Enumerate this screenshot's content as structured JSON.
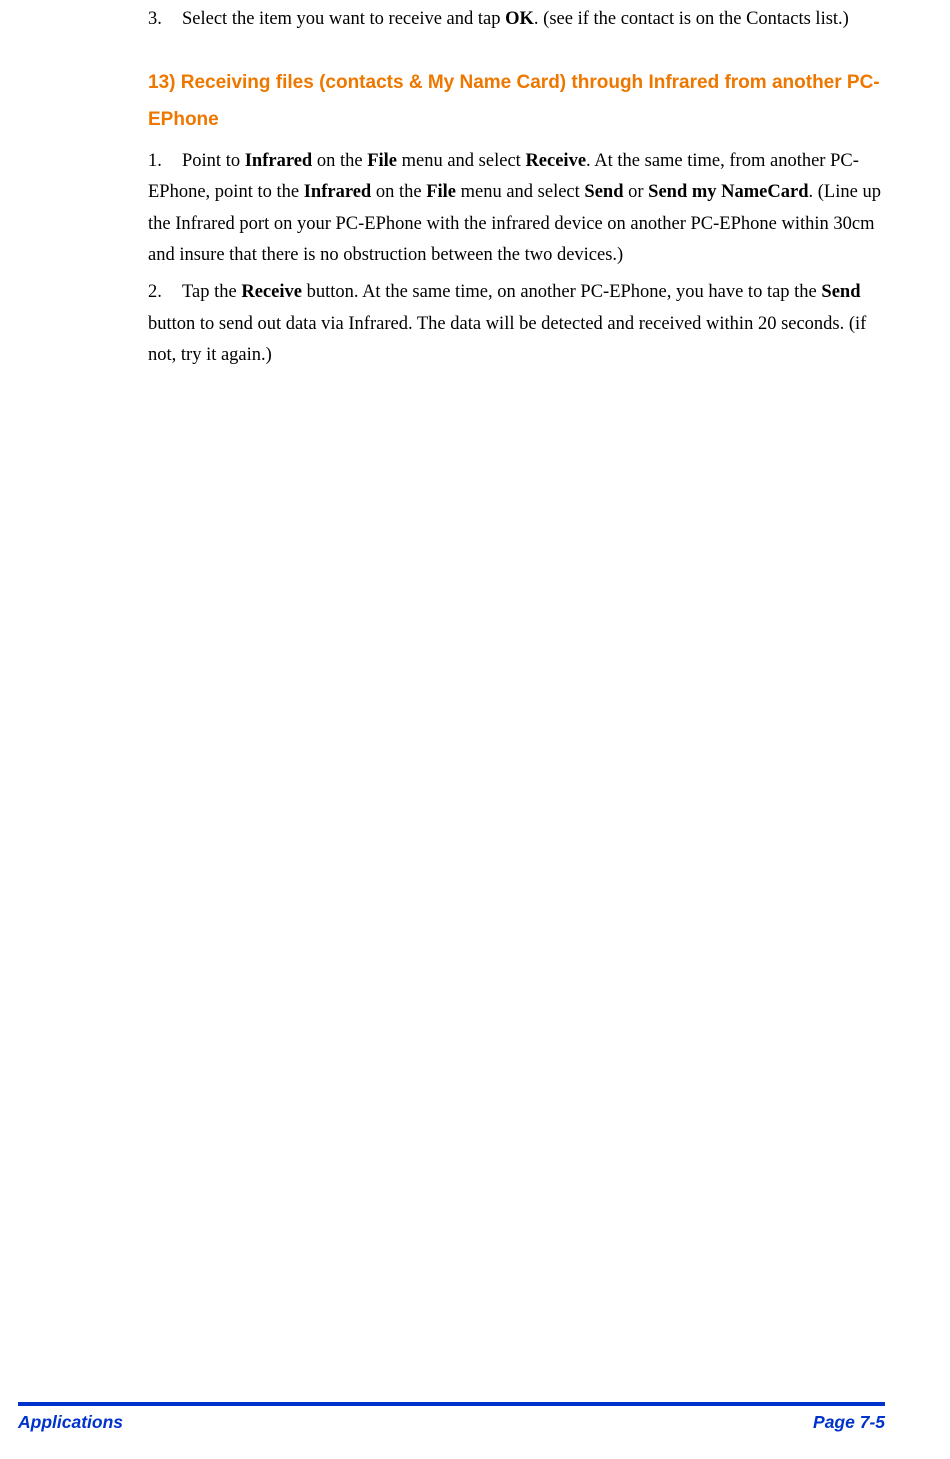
{
  "step3": {
    "number": "3.",
    "text_before_ok": "Select the item you want to receive and tap ",
    "ok": "OK",
    "text_after_ok": ". (see if  the contact is on the Contacts list.)"
  },
  "section_heading": "13)  Receiving files (contacts & My Name Card) through Infrared from another PC-EPhone",
  "step1": {
    "number": "1.",
    "t1": "Point to ",
    "b1": "Infrared",
    "t2": " on the ",
    "b2": "File",
    "t3": " menu and select ",
    "b3": "Receive",
    "t4": ". At the same time, from another PC-EPhone, point to the ",
    "b4": "Infrared",
    "t5": " on the ",
    "b5": "File",
    "t6": " menu and select ",
    "b6": "Send",
    "t7": " or ",
    "b7": "Send my NameCard",
    "t8": ". (Line up the Infrared port on your PC-EPhone with the infrared device on another PC-EPhone within 30cm and insure that there is no obstruction between the two devices.)"
  },
  "step2": {
    "number": "2.",
    "t1": "Tap the ",
    "b1": "Receive",
    "t2": " button. At the same time, on another PC-EPhone, you have to tap the ",
    "b2": "Send",
    "t3": " button to send out data via Infrared. The data will be detected and received within 20 seconds. (if not, try it again.)"
  },
  "footer": {
    "left": "Applications",
    "right": "Page 7-5"
  }
}
